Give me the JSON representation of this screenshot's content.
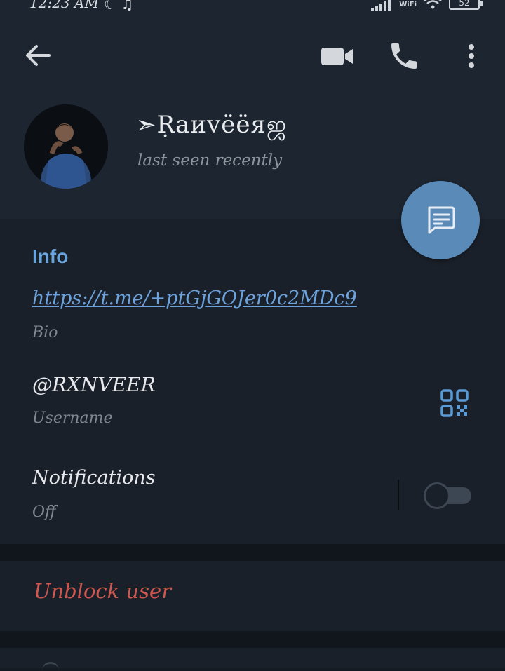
{
  "status_bar": {
    "time": "12:23 AM",
    "wifi_label": "WiFi",
    "battery": "52",
    "icons": [
      "moon-icon",
      "headphones-icon",
      "signal-icon",
      "wifi-icon",
      "battery-icon"
    ]
  },
  "toolbar": {
    "icons": [
      "back-arrow-icon",
      "video-call-icon",
      "phone-icon",
      "more-vertical-icon"
    ]
  },
  "profile": {
    "name": "➣Ṛaиvёёяஜ",
    "status": "last seen recently"
  },
  "fab": {
    "icon": "message-icon"
  },
  "info": {
    "heading": "Info",
    "bio_link": "https://t.me/+ptGjGOJer0c2MDc9",
    "bio_caption": "Bio",
    "username": "@RXNVEER",
    "username_caption": "Username",
    "qr_icon": "qr-code-icon",
    "notifications_label": "Notifications",
    "notifications_value": "Off",
    "notifications_enabled": false
  },
  "actions": {
    "unblock_label": "Unblock user"
  },
  "colors": {
    "accent": "#69a4dc",
    "fab": "#5a8ab8",
    "danger": "#d0574f",
    "background": "#1a202a",
    "header": "#1d2530"
  }
}
